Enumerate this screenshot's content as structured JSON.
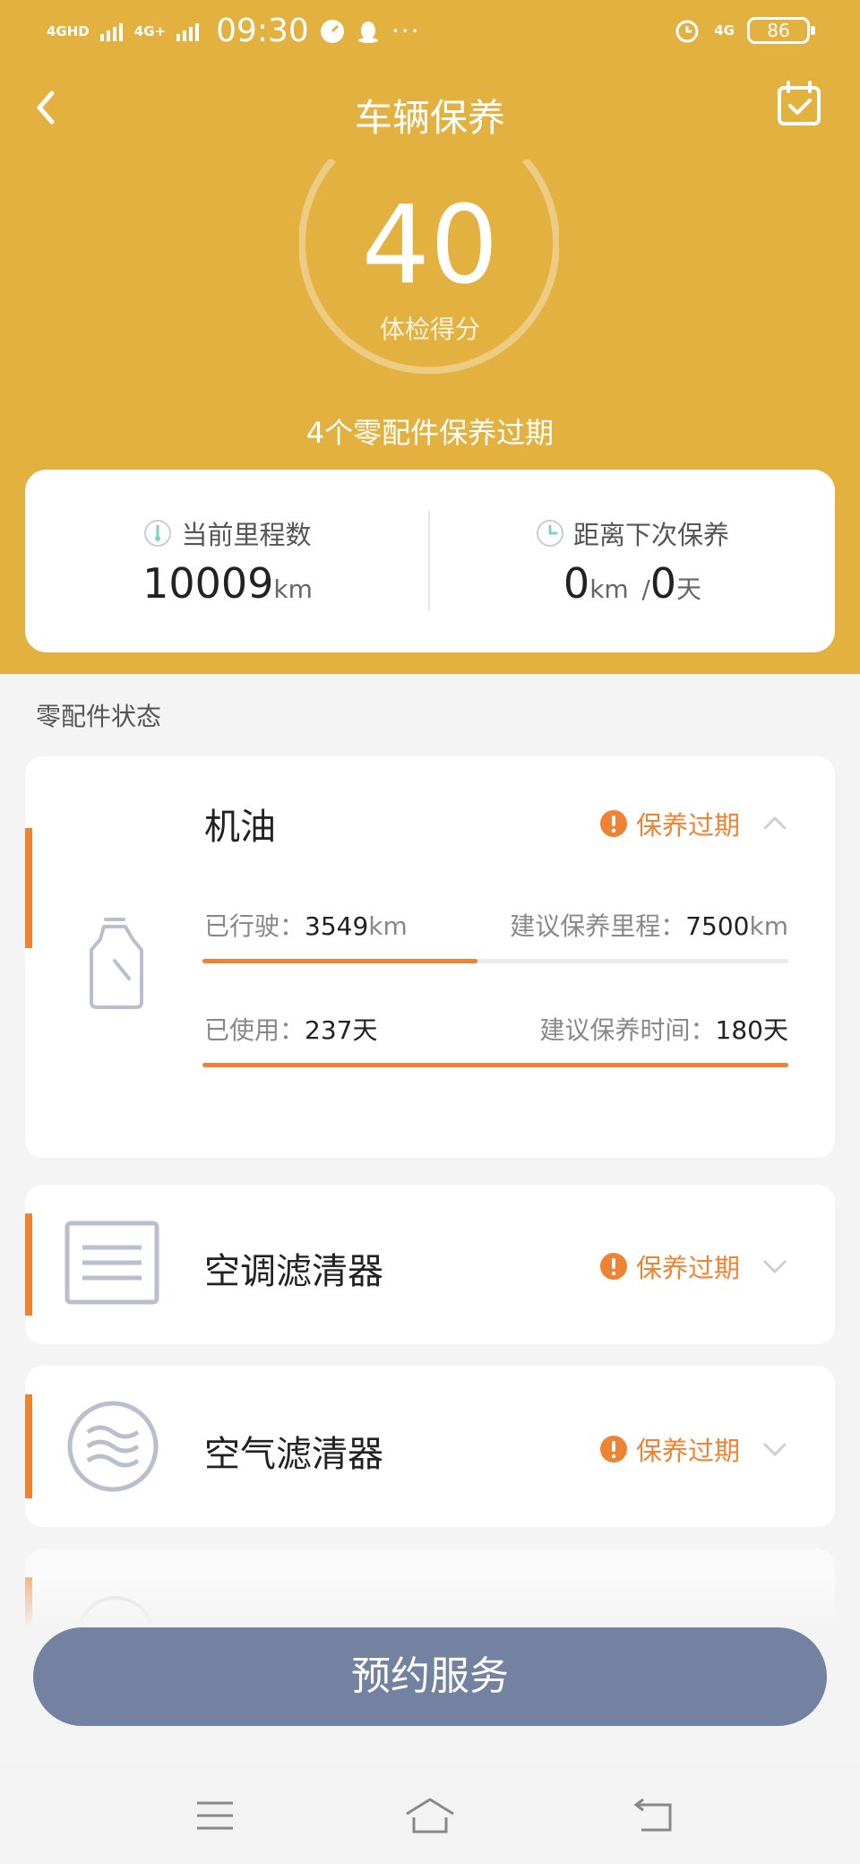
{
  "status_bar": {
    "net1": "4GHD",
    "net2": "4G+",
    "time": "09:30",
    "net3": "4G",
    "battery": "86"
  },
  "nav": {
    "title": "车辆保养"
  },
  "score": {
    "value": "40",
    "label": "体检得分",
    "ring_fraction": 0.4,
    "summary": "4个零配件保养过期"
  },
  "stats": {
    "mileage": {
      "label": "当前里程数",
      "value": "10009",
      "unit": "km"
    },
    "next": {
      "label": "距离下次保养",
      "km_value": "0",
      "km_unit": "km",
      "sep": "/",
      "day_value": "0",
      "day_unit": "天"
    }
  },
  "section_title": "零配件状态",
  "parts": [
    {
      "name": "机油",
      "status": "保养过期",
      "icon": "oil-bottle-icon",
      "driven_label": "已行驶：",
      "driven_value": "3549",
      "driven_unit": "km",
      "suggest_km_label": "建议保养里程：",
      "suggest_km_value": "7500",
      "suggest_km_unit": "km",
      "driven_progress": 0.47,
      "used_label": "已使用：",
      "used_value": "237",
      "used_unit": "天",
      "suggest_time_label": "建议保养时间：",
      "suggest_time_value": "180",
      "suggest_time_unit": "天",
      "used_progress": 1.0
    },
    {
      "name": "空调滤清器",
      "status": "保养过期",
      "icon": "ac-filter-icon"
    },
    {
      "name": "空气滤清器",
      "status": "保养过期",
      "icon": "air-filter-icon"
    }
  ],
  "reserve_button": "预约服务",
  "colors": {
    "header": "#e2b13f",
    "accent": "#ee8433",
    "button": "#7282a0"
  }
}
